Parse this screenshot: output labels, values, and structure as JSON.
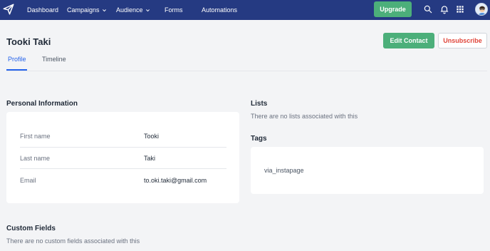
{
  "nav": {
    "items": [
      {
        "label": "Dashboard"
      },
      {
        "label": "Campaigns"
      },
      {
        "label": "Audience"
      },
      {
        "label": "Forms"
      },
      {
        "label": "Automations"
      }
    ],
    "upgrade_label": "Upgrade",
    "icons": [
      "search-icon",
      "bell-icon",
      "apps-grid-icon",
      "avatar"
    ]
  },
  "contact": {
    "name": "Tooki Taki",
    "edit_label": "Edit Contact",
    "unsubscribe_label": "Unsubscribe"
  },
  "tabs": [
    {
      "label": "Profile",
      "active": true
    },
    {
      "label": "Timeline",
      "active": false
    }
  ],
  "personal": {
    "title": "Personal Information",
    "rows": [
      {
        "label": "First name",
        "value": "Tooki"
      },
      {
        "label": "Last name",
        "value": "Taki"
      },
      {
        "label": "Email",
        "value": "to.oki.taki@gmail.com"
      }
    ]
  },
  "lists": {
    "title": "Lists",
    "empty": "There are no lists associated with this"
  },
  "tags": {
    "title": "Tags",
    "items": [
      "via_instapage"
    ]
  },
  "custom_fields": {
    "title": "Custom Fields",
    "empty": "There are no custom fields associated with this"
  },
  "colors": {
    "topbar": "#253a82",
    "green": "#4caf7a",
    "active_tab": "#2563eb",
    "unsubscribe": "#e0453a"
  }
}
